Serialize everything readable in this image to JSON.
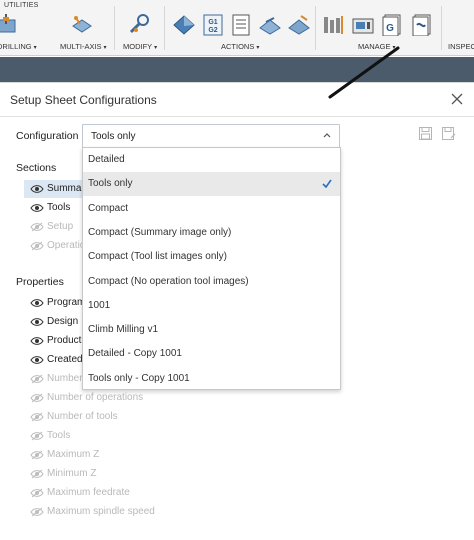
{
  "toolbar": {
    "utilities_label": "UTILITIES",
    "groups": {
      "drilling": "DRILLING",
      "multi_axis": "MULTI-AXIS",
      "modify": "MODIFY",
      "actions": "ACTIONS",
      "manage": "MANAGE",
      "inspect": "INSPECT"
    },
    "g1g2_icon_text": "G1\nG2",
    "g_icon_text": "G",
    "caret": "▾"
  },
  "dialog": {
    "title": "Setup Sheet Configurations",
    "configuration_label": "Configuration",
    "configuration_value": "Tools only",
    "sections_title": "Sections",
    "sections": [
      {
        "label": "Summary",
        "visible": true,
        "selected": true
      },
      {
        "label": "Tools",
        "visible": true,
        "selected": false
      },
      {
        "label": "Setup",
        "visible": false,
        "selected": false
      },
      {
        "label": "Operations",
        "visible": false,
        "selected": false
      }
    ],
    "properties_title": "Properties",
    "properties": [
      {
        "label": "Program",
        "visible": true
      },
      {
        "label": "Design",
        "visible": true
      },
      {
        "label": "Product",
        "visible": true
      },
      {
        "label": "Created",
        "visible": true
      },
      {
        "label": "Number",
        "visible": false
      },
      {
        "label": "Number of operations",
        "visible": false
      },
      {
        "label": "Number of tools",
        "visible": false
      },
      {
        "label": "Tools",
        "visible": false
      },
      {
        "label": "Maximum Z",
        "visible": false
      },
      {
        "label": "Minimum Z",
        "visible": false
      },
      {
        "label": "Maximum feedrate",
        "visible": false
      },
      {
        "label": "Maximum spindle speed",
        "visible": false
      }
    ]
  },
  "dropdown": {
    "options": [
      {
        "label": "Detailed",
        "active": false
      },
      {
        "label": "Tools only",
        "active": true
      },
      {
        "label": "Compact",
        "active": false
      },
      {
        "label": "Compact (Summary image only)",
        "active": false
      },
      {
        "label": "Compact (Tool list images only)",
        "active": false
      },
      {
        "label": "Compact (No operation tool images)",
        "active": false
      },
      {
        "label": "1001",
        "active": false
      },
      {
        "label": "Climb Milling v1",
        "active": false
      },
      {
        "label": "Detailed - Copy 1001",
        "active": false
      },
      {
        "label": "Tools only - Copy 1001",
        "active": false
      }
    ]
  },
  "colors": {
    "toolbar_bg": "#f4f4f4",
    "band": "#4c5b6c",
    "selection": "#dbe7f3",
    "active_option": "#e9e9e9",
    "check": "#2a6fb8",
    "muted_text": "#b9b9b9"
  }
}
